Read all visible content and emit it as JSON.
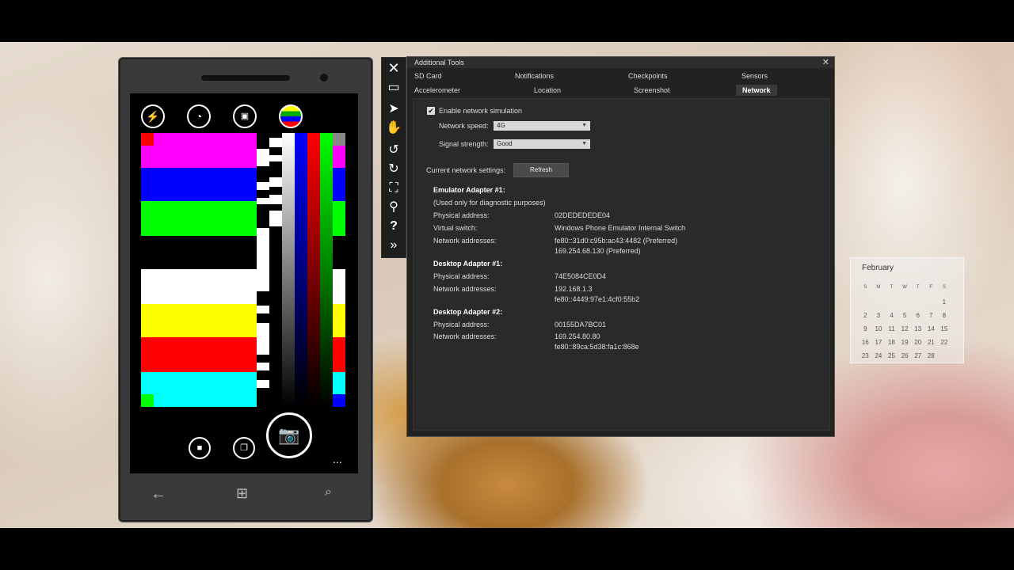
{
  "dialog": {
    "title": "Additional Tools",
    "tabs": [
      {
        "label": "SD Card"
      },
      {
        "label": "Notifications"
      },
      {
        "label": "Checkpoints"
      },
      {
        "label": "Sensors"
      },
      {
        "label": "Accelerometer"
      },
      {
        "label": "Location"
      },
      {
        "label": "Screenshot"
      },
      {
        "label": "Network"
      }
    ],
    "active_tab": "Network",
    "network": {
      "enable_label": "Enable network simulation",
      "enabled": true,
      "speed_label": "Network speed:",
      "speed_value": "4G",
      "signal_label": "Signal strength:",
      "signal_value": "Good",
      "current_label": "Current network settings:",
      "refresh_label": "Refresh",
      "adapters": {
        "emulator1": {
          "title": "Emulator Adapter #1:",
          "note": "(Used only for diagnostic purposes)",
          "physical_label": "Physical address:",
          "physical": "02DEDEDEDE04",
          "switch_label": "Virtual switch:",
          "switch": "Windows Phone Emulator Internal Switch",
          "addresses_label": "Network addresses:",
          "addr1": "fe80::31d0:c95b:ac43:4482 (Preferred)",
          "addr2": "169.254.68.130 (Preferred)"
        },
        "desktop1": {
          "title": "Desktop Adapter #1:",
          "physical_label": "Physical address:",
          "physical": "74E5084CE0D4",
          "addresses_label": "Network addresses:",
          "addr1": "192.168.1.3",
          "addr2": "fe80::4449:97e1:4cf0:55b2"
        },
        "desktop2": {
          "title": "Desktop Adapter #2:",
          "physical_label": "Physical address:",
          "physical": "00155DA7BC01",
          "addresses_label": "Network addresses:",
          "addr1": "169.254.80.80",
          "addr2": "fe80::89ca:5d38:fa1c:868e"
        }
      }
    }
  },
  "toolbar": {
    "icons": [
      "close-icon",
      "minimize-icon",
      "pointer-icon",
      "hand-icon",
      "rotate-left-icon",
      "rotate-right-icon",
      "fit-screen-icon",
      "zoom-icon",
      "help-icon",
      "expand-icon"
    ]
  },
  "phone": {
    "camera_icons": [
      "flash-icon",
      "timer-icon",
      "lens-icon",
      "color-effect-icon"
    ],
    "controls": [
      "video-icon",
      "gallery-icon",
      "shutter-icon",
      "more-icon"
    ],
    "more_label": "...",
    "colors": {
      "magenta": "#ff00ff",
      "blue": "#0000ff",
      "green": "#00ff00",
      "white": "#ffffff",
      "yellow": "#ffff00",
      "red": "#ff0000",
      "cyan": "#00ffff"
    }
  },
  "calendar": {
    "month": "February",
    "weekdays": [
      "S",
      "M",
      "T",
      "W",
      "T",
      "F",
      "S"
    ],
    "weeks": [
      [
        "",
        "",
        "",
        "",
        "",
        "",
        "1"
      ],
      [
        "2",
        "3",
        "4",
        "5",
        "6",
        "7",
        "8"
      ],
      [
        "9",
        "10",
        "11",
        "12",
        "13",
        "14",
        "15"
      ],
      [
        "16",
        "17",
        "18",
        "19",
        "20",
        "21",
        "22"
      ],
      [
        "23",
        "24",
        "25",
        "26",
        "27",
        "28",
        ""
      ]
    ]
  }
}
